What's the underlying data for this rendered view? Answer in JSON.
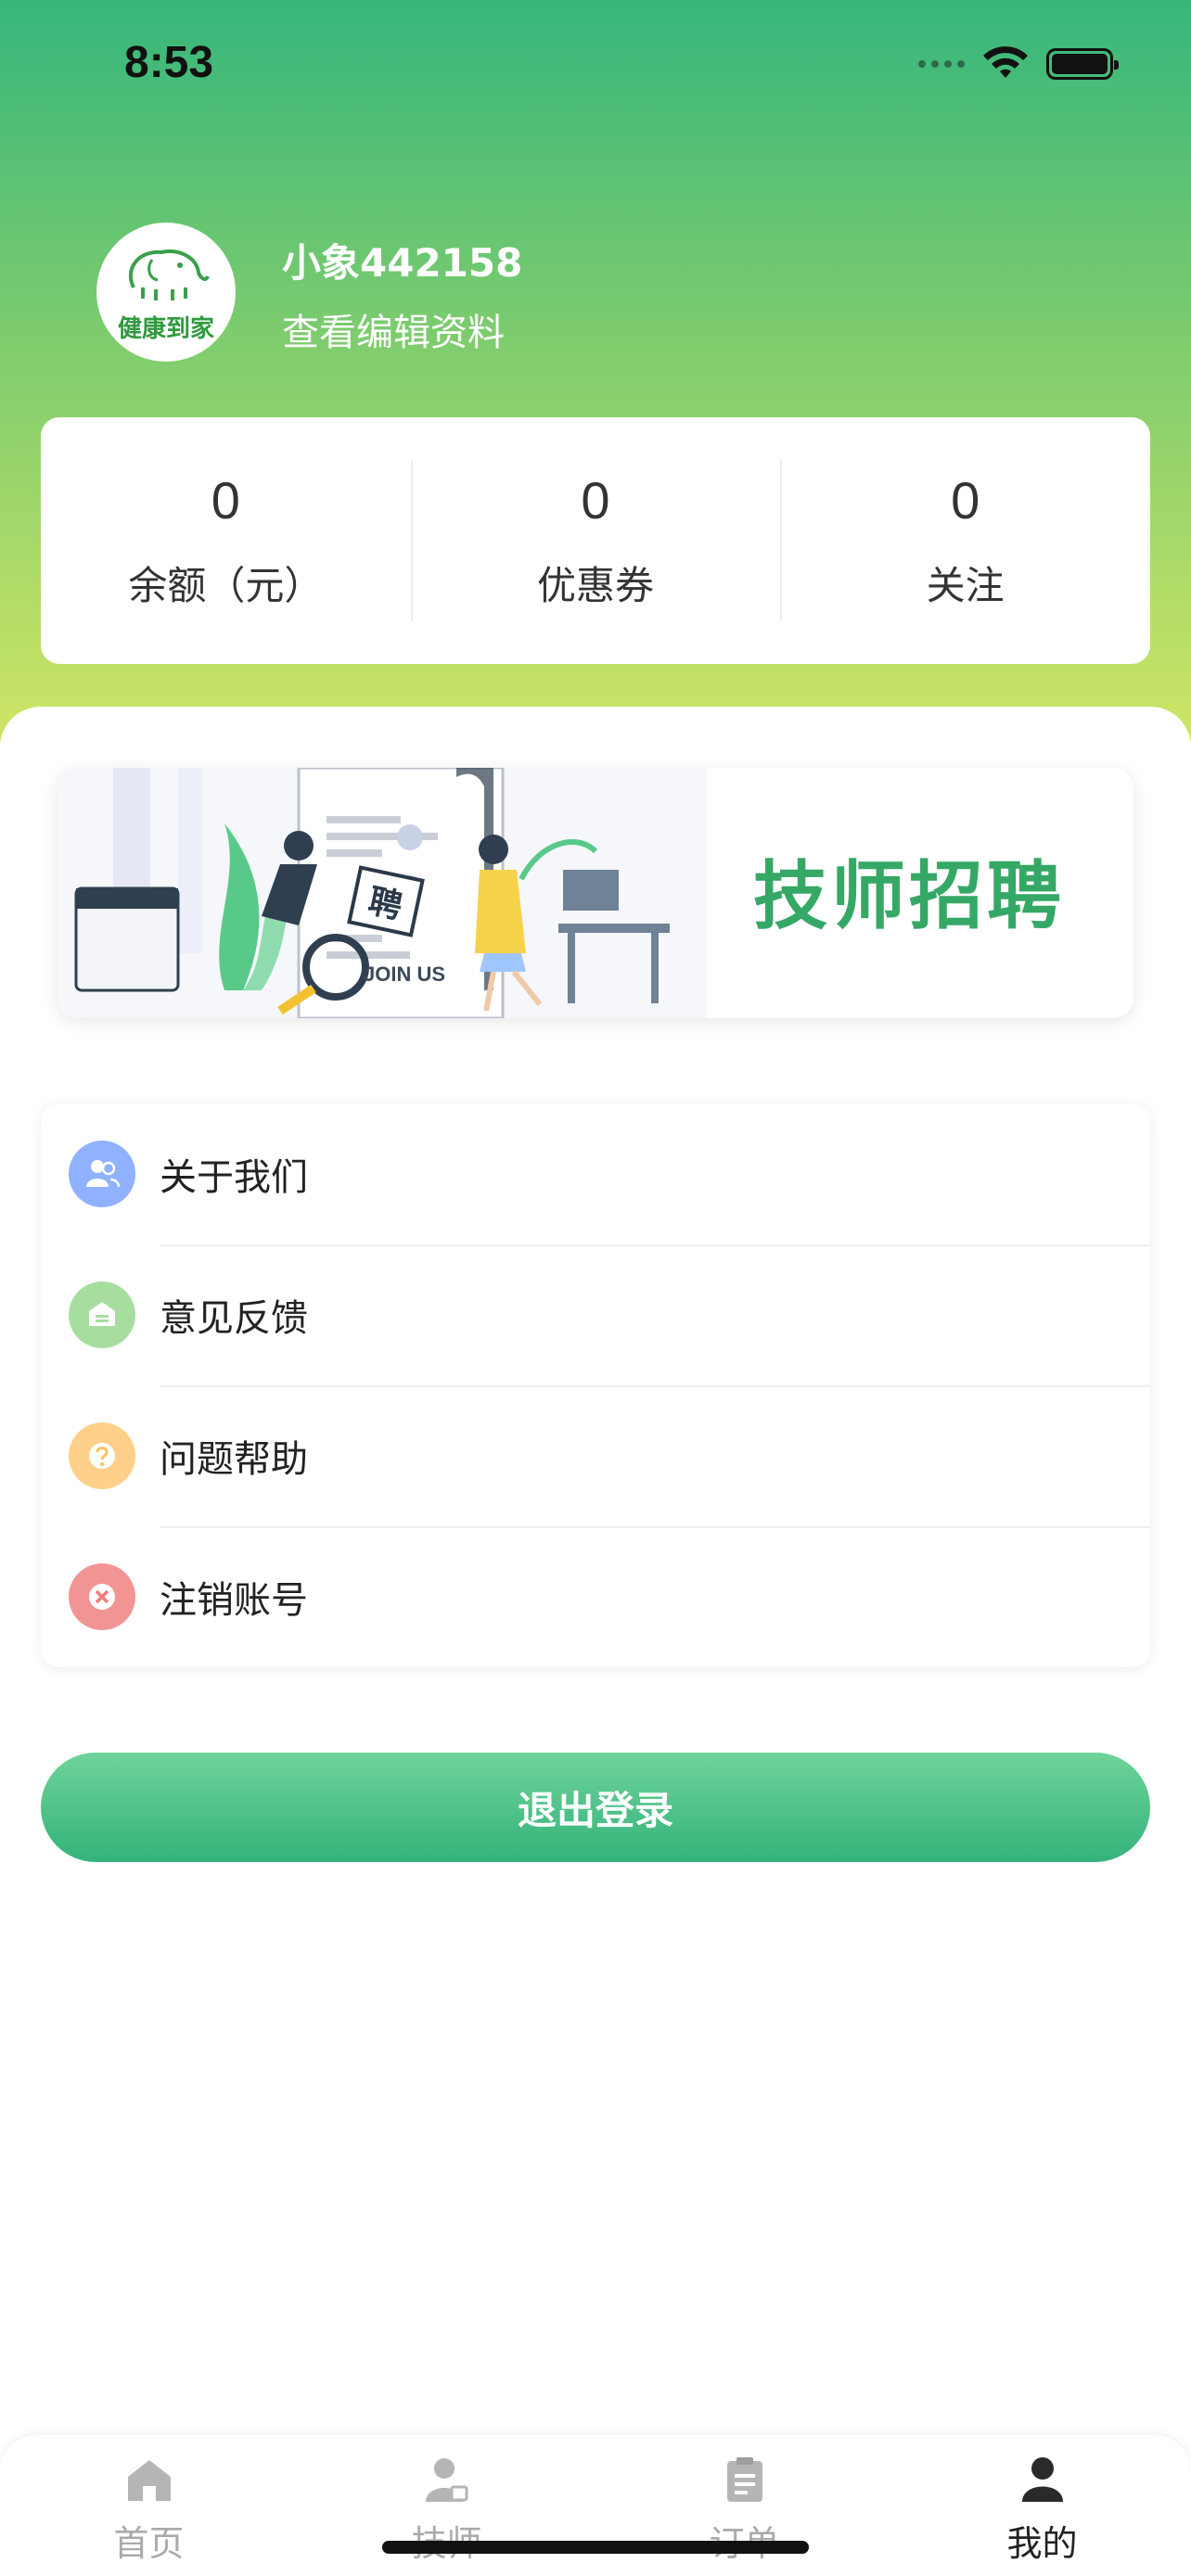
{
  "status_bar": {
    "time": "8:53"
  },
  "profile": {
    "avatar_brand": "健康到家",
    "username": "小象442158",
    "edit_link": "查看编辑资料"
  },
  "stats": [
    {
      "value": "0",
      "label": "余额（元）"
    },
    {
      "value": "0",
      "label": "优惠券"
    },
    {
      "value": "0",
      "label": "关注"
    }
  ],
  "banner": {
    "title": "技师招聘",
    "badge": "聘",
    "join_text": "JOIN US"
  },
  "menu": [
    {
      "label": "关于我们",
      "icon": "users-icon",
      "color": "#8fb1ff"
    },
    {
      "label": "意见反馈",
      "icon": "feedback-icon",
      "color": "#a7dea0"
    },
    {
      "label": "问题帮助",
      "icon": "help-icon",
      "color": "#ffd08a"
    },
    {
      "label": "注销账号",
      "icon": "close-circle-icon",
      "color": "#f39494"
    }
  ],
  "logout_label": "退出登录",
  "tabs": [
    {
      "label": "首页",
      "icon": "home-icon",
      "active": false
    },
    {
      "label": "技师",
      "icon": "technician-icon",
      "active": false
    },
    {
      "label": "订单",
      "icon": "order-icon",
      "active": false
    },
    {
      "label": "我的",
      "icon": "profile-icon",
      "active": true
    }
  ],
  "colors": {
    "header_top": "#36b67b",
    "header_bottom": "#cfe565",
    "accent": "#35a866",
    "logout_button": "#33b37a"
  }
}
